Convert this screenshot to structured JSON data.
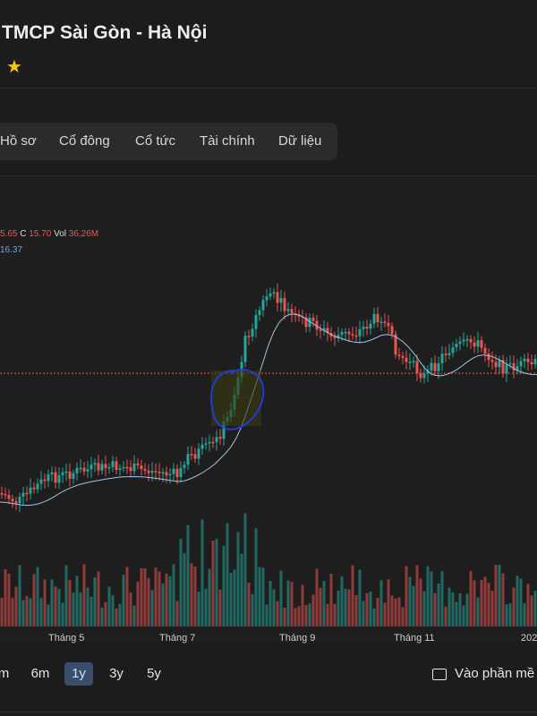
{
  "header": {
    "title": "TMCP Sài Gòn - Hà Nội",
    "star_icon": "star-icon"
  },
  "tabs": [
    {
      "label": "Hồ sơ"
    },
    {
      "label": "Cổ đông"
    },
    {
      "label": "Cổ tức"
    },
    {
      "label": "Tài chính"
    },
    {
      "label": "Dữ liệu"
    }
  ],
  "ohlc": {
    "low_value": "5.65",
    "close_label": "C",
    "close_value": "15.70",
    "vol_label": "Vol",
    "vol_value": "36,26M",
    "ma_value": "16.37"
  },
  "x_axis": [
    "Tháng 5",
    "Tháng 7",
    "Tháng 9",
    "Tháng 11",
    "202"
  ],
  "ranges": [
    {
      "label": "m"
    },
    {
      "label": "6m"
    },
    {
      "label": "1y",
      "active": true
    },
    {
      "label": "3y"
    },
    {
      "label": "5y"
    }
  ],
  "fullscreen_label": "Vào phần mề",
  "colors": {
    "up": "#26a69a",
    "down": "#ef5350",
    "ma": "#9ec5e8",
    "annotation": "#1f3bd8"
  }
}
